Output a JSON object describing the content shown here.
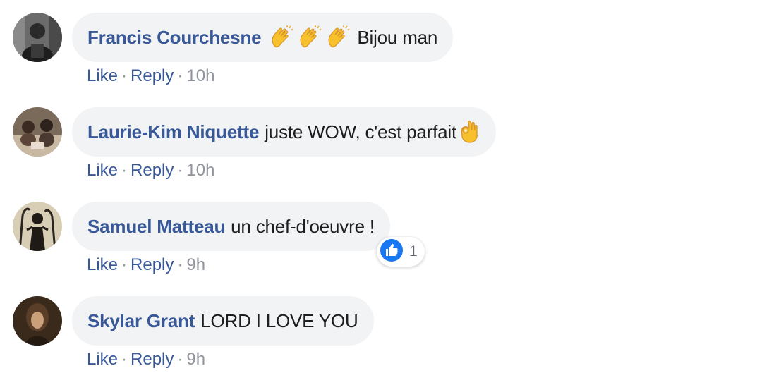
{
  "accent_colors": {
    "author": "#385898",
    "meta": "#90949c",
    "bubble": "#f2f3f5",
    "like_blue": "#1877f2"
  },
  "comments": [
    {
      "author": "Francis Courchesne",
      "text": "Bijou man",
      "emoji_prefix": [
        "clapping-hands-icon",
        "clapping-hands-icon",
        "clapping-hands-icon"
      ],
      "actions": {
        "like": "Like",
        "reply": "Reply",
        "sep": "·",
        "time": "10h"
      }
    },
    {
      "author": "Laurie-Kim Niquette",
      "text": "juste WOW, c'est parfait",
      "emoji_suffix": [
        "ok-hand-icon"
      ],
      "actions": {
        "like": "Like",
        "reply": "Reply",
        "sep": "·",
        "time": "10h"
      }
    },
    {
      "author": "Samuel Matteau",
      "text": "un chef-d'oeuvre !",
      "reaction": {
        "icon": "thumbs-up-icon",
        "count": "1"
      },
      "actions": {
        "like": "Like",
        "reply": "Reply",
        "sep": "·",
        "time": "9h"
      }
    },
    {
      "author": "Skylar Grant",
      "text": "LORD I LOVE YOU",
      "actions": {
        "like": "Like",
        "reply": "Reply",
        "sep": "·",
        "time": "9h"
      }
    }
  ]
}
